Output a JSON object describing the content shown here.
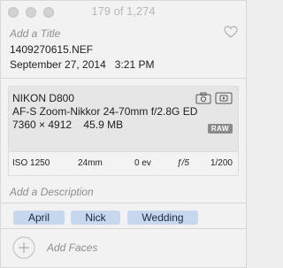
{
  "window": {
    "counter": "179 of 1,274"
  },
  "photo": {
    "title_placeholder": "Add a Title",
    "filename": "1409270615.NEF",
    "date": "September 27, 2014",
    "time": "3:21 PM"
  },
  "camera": {
    "model": "NIKON D800",
    "lens": "AF-S Zoom-Nikkor 24-70mm f/2.8G ED",
    "dimensions": "7360 × 4912",
    "file_size": "45.9 MB",
    "format_badge": "RAW",
    "icons": [
      "camera-wb-icon",
      "metering-icon"
    ]
  },
  "exposure": {
    "iso": "ISO 1250",
    "focal_length": "24mm",
    "exposure_bias": "0 ev",
    "aperture": "ƒ/5",
    "shutter": "1/200"
  },
  "description": {
    "placeholder": "Add a Description"
  },
  "keywords": [
    "April",
    "Nick",
    "Wedding"
  ],
  "faces": {
    "label": "Add Faces"
  },
  "colors": {
    "keyword_bg": "#c7d7ee",
    "placeholder_text": "#8e8e8e",
    "raw_badge": "#8a8a8a"
  }
}
